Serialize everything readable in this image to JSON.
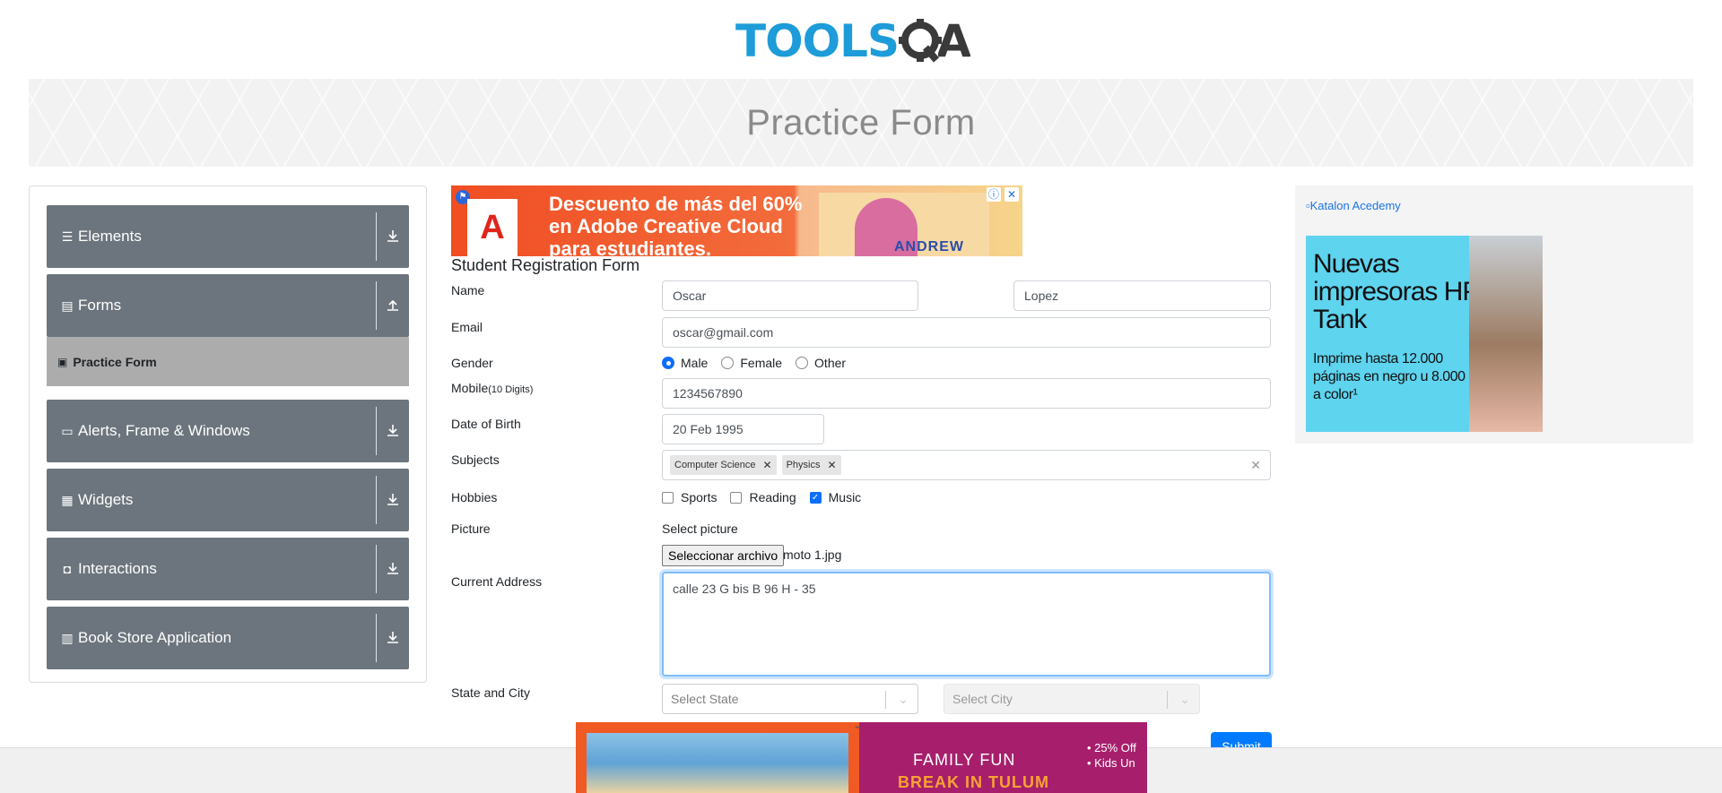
{
  "logo": {
    "part1": "TOOLS",
    "part2": "QA"
  },
  "banner": {
    "title": "Practice Form"
  },
  "sidebar": {
    "groups": [
      {
        "label": "Elements",
        "icon": "list-icon",
        "toggle": "down"
      },
      {
        "label": "Forms",
        "icon": "document-icon",
        "toggle": "up"
      },
      {
        "label": "Alerts, Frame & Windows",
        "icon": "window-icon",
        "toggle": "down"
      },
      {
        "label": "Widgets",
        "icon": "grid-icon",
        "toggle": "down"
      },
      {
        "label": "Interactions",
        "icon": "interaction-icon",
        "toggle": "down"
      },
      {
        "label": "Book Store Application",
        "icon": "books-icon",
        "toggle": "down"
      }
    ],
    "active_item": "Practice Form"
  },
  "ad_top": {
    "text_line1": "Descuento de más del 60%",
    "text_line2": "en Adobe Creative Cloud",
    "text_line3": "para estudiantes.",
    "name": "ANDREW"
  },
  "form": {
    "title": "Student Registration Form",
    "name_label": "Name",
    "first_name": "Oscar",
    "last_name": "Lopez",
    "email_label": "Email",
    "email": "oscar@gmail.com",
    "gender_label": "Gender",
    "gender_options": [
      "Male",
      "Female",
      "Other"
    ],
    "gender_selected": "Male",
    "mobile_label": "Mobile",
    "mobile_hint": "(10 Digits)",
    "mobile": "1234567890",
    "dob_label": "Date of Birth",
    "dob": "20 Feb 1995",
    "subjects_label": "Subjects",
    "subjects": [
      "Computer Science",
      "Physics"
    ],
    "hobbies_label": "Hobbies",
    "hobbies": [
      "Sports",
      "Reading",
      "Music"
    ],
    "hobbies_checked": [
      "Music"
    ],
    "picture_label": "Picture",
    "picture_hint": "Select picture",
    "file_button": "Seleccionar archivo",
    "file_name": "moto 1.jpg",
    "address_label": "Current Address",
    "address": "calle 23 G bis B 96 H - 35",
    "state_city_label": "State and City",
    "state_placeholder": "Select State",
    "city_placeholder": "Select City",
    "submit": "Submit"
  },
  "ad_right": {
    "alt": "Katalon Acedemy",
    "headline": "Nuevas impresoras HP Tank",
    "sub": "Imprime hasta 12.000 páginas en negro u 8.000 a color¹"
  },
  "ad_bottom": {
    "line1": "FAMILY FUN",
    "line2": "BREAK IN TULUM",
    "side1": "• 25% Off",
    "side2": "• Kids Un"
  },
  "colors": {
    "accent": "#007bff",
    "sidebar_bg": "#6c757d",
    "active_bg": "#acacac",
    "logo_blue": "#1d9cd9"
  }
}
